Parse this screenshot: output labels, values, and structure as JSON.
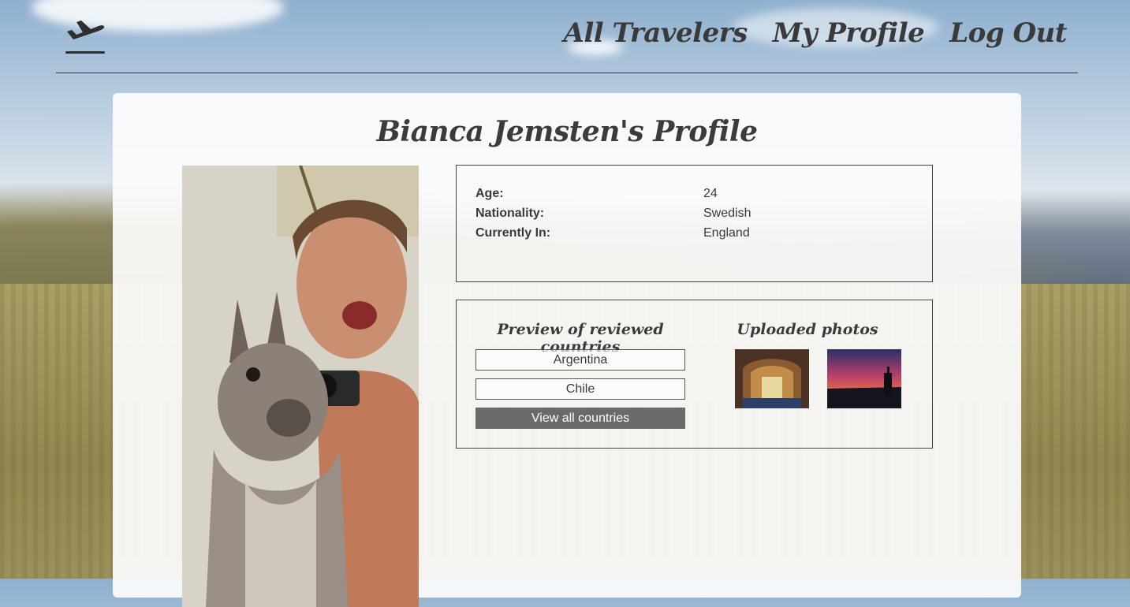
{
  "header": {
    "logo_icon": "plane-takeoff-icon",
    "nav": [
      "All Travelers",
      "My Profile",
      "Log Out"
    ]
  },
  "profile": {
    "title": "Bianca Jemsten's Profile",
    "photo_icon": "profile-photo",
    "fields": [
      {
        "label": "Age:",
        "value": "24"
      },
      {
        "label": "Nationality:",
        "value": "Swedish"
      },
      {
        "label": "Currently In:",
        "value": "England"
      }
    ]
  },
  "countries": {
    "heading": "Preview of reviewed countries",
    "items": [
      "Argentina",
      "Chile"
    ],
    "view_all_label": "View all countries"
  },
  "photos": {
    "heading": "Uploaded photos"
  },
  "colors": {
    "text": "#3a3a3a",
    "button_bg": "#6a6a6a"
  }
}
